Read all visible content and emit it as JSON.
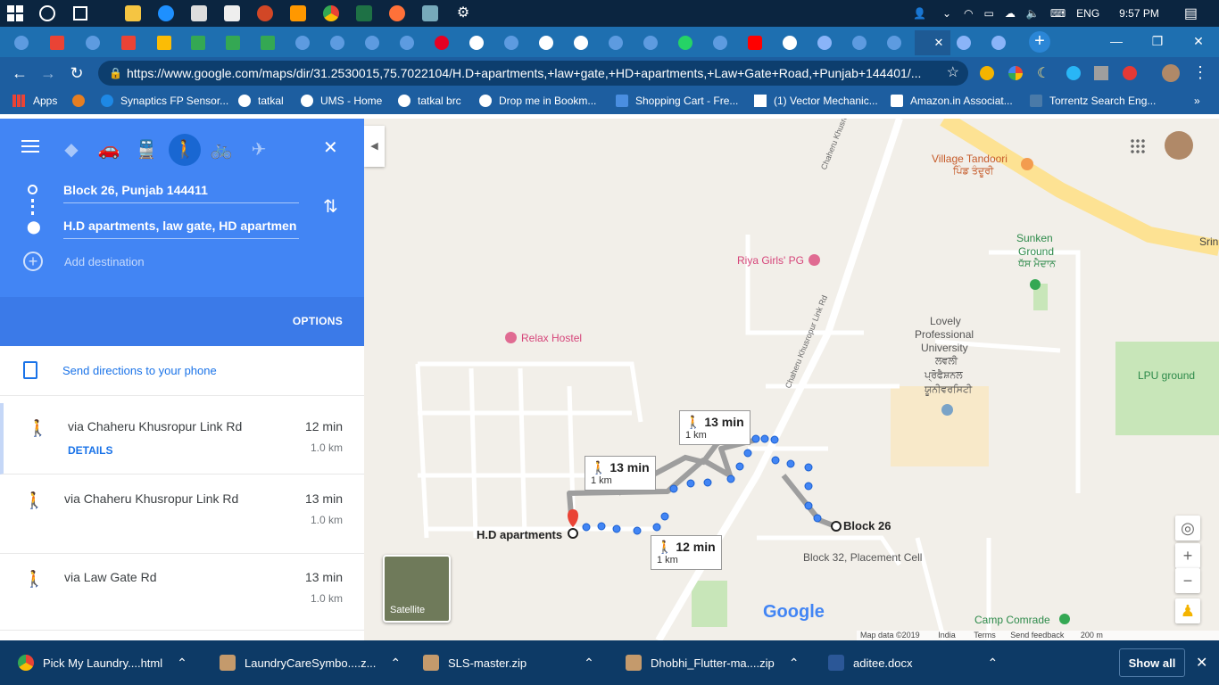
{
  "taskbar": {
    "lang": "ENG",
    "clock": "9:57 PM"
  },
  "browser": {
    "url": "https://www.google.com/maps/dir/31.2530015,75.7022104/H.D+apartments,+law+gate,+HD+apartments,+Law+Gate+Road,+Punjab+144401/..."
  },
  "bookmarks": [
    {
      "label": "Apps"
    },
    {
      "label": "Synaptics FP Sensor..."
    },
    {
      "label": "tatkal"
    },
    {
      "label": "UMS - Home"
    },
    {
      "label": "tatkal brc"
    },
    {
      "label": "Drop me in Bookm..."
    },
    {
      "label": "Shopping Cart - Fre..."
    },
    {
      "label": "(1) Vector Mechanic..."
    },
    {
      "label": "Amazon.in Associat..."
    },
    {
      "label": "Torrentz Search Eng..."
    }
  ],
  "directions": {
    "origin": "Block 26, Punjab 144411",
    "destination": "H.D apartments, law gate, HD apartmen",
    "add_destination": "Add destination",
    "options": "OPTIONS",
    "send_to_phone": "Send directions to your phone",
    "routes": [
      {
        "via": "via Chaheru Khusropur Link Rd",
        "time": "12 min",
        "distance": "1.0 km",
        "details": "DETAILS"
      },
      {
        "via": "via Chaheru Khusropur Link Rd",
        "time": "13 min",
        "distance": "1.0 km"
      },
      {
        "via": "via Law Gate Rd",
        "time": "13 min",
        "distance": "1.0 km"
      }
    ]
  },
  "map": {
    "labels": {
      "village_tandoori": "Village Tandoori",
      "village_tandoori_pa": "ਪਿੰਡ ਤੰਦੂਰੀ",
      "sunken_ground": "Sunken",
      "sunken_ground2": "Ground",
      "sunken_ground_pa": "ਧੱਸ ਮੈਦਾਨ",
      "riya": "Riya Girls' PG",
      "relax": "Relax Hostel",
      "lpu1": "Lovely",
      "lpu2": "Professional",
      "lpu3": "University",
      "lpu_pa1": "ਲਵਲੀ",
      "lpu_pa2": "ਪ੍ਰੋਫੈਸ਼ਨਲ",
      "lpu_pa3": "ਯੂਨੀਵਰਸਿਟੀ",
      "lpu_ground": "LPU ground",
      "block26": "Block 26",
      "block32": "Block 32, Placement Cell",
      "hd": "H.D apartments",
      "camp": "Camp Comrade",
      "road1": "Chaheru Khusropur Link Rd",
      "road2": "Chaheru Khusropur Link Rd",
      "srin": "Srin",
      "satellite": "Satellite",
      "google": "Google",
      "footer_data": "Map data ©2019",
      "footer_india": "India",
      "footer_terms": "Terms",
      "footer_feedback": "Send feedback",
      "footer_scale": "200 m"
    },
    "callouts": [
      {
        "time": "13 min",
        "dist": "1 km"
      },
      {
        "time": "13 min",
        "dist": "1 km"
      },
      {
        "time": "12 min",
        "dist": "1 km"
      }
    ]
  },
  "downloads": [
    {
      "name": "Pick My Laundry....html"
    },
    {
      "name": "LaundryCareSymbo....z..."
    },
    {
      "name": "SLS-master.zip"
    },
    {
      "name": "Dhobhi_Flutter-ma....zip"
    },
    {
      "name": "aditee.docx"
    }
  ],
  "show_all": "Show all",
  "colors": {
    "accent": "#4285f4",
    "route_blue": "#4285f4",
    "alt_route": "#9e9e9e"
  }
}
